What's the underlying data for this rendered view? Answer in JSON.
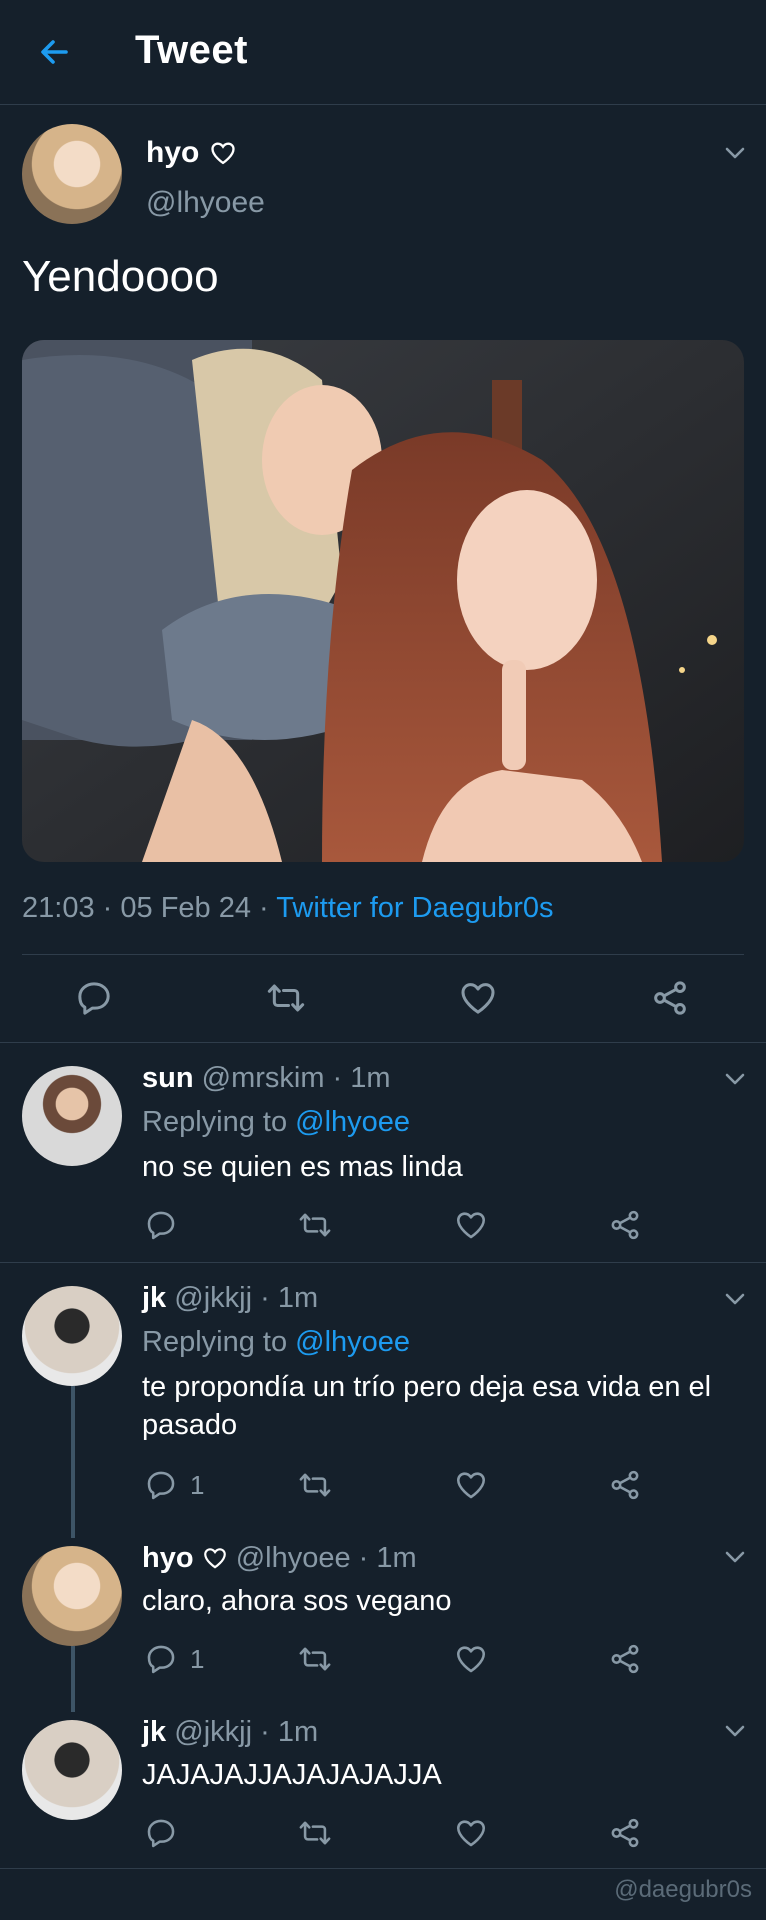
{
  "header": {
    "title": "Tweet"
  },
  "main_tweet": {
    "name": "hyo",
    "handle": "@lhyoee",
    "text": "Yendoooo",
    "time": "21:03",
    "date": "05 Feb 24",
    "sep": "·",
    "client": "Twitter for Daegubr0s"
  },
  "replies": [
    {
      "name": "sun",
      "handle": "@mrskim",
      "time": "1m",
      "replying_prefix": "Replying to",
      "replying_to": "@lhyoee",
      "text": "no se quien es mas linda",
      "reply_count": ""
    },
    {
      "name": "jk",
      "handle": "@jkkjj",
      "time": "1m",
      "replying_prefix": "Replying to",
      "replying_to": "@lhyoee",
      "text": "te propondía un trío pero deja esa vida en el pasado",
      "reply_count": "1"
    },
    {
      "name": "hyo",
      "handle": "@lhyoee",
      "time": "1m",
      "text": "claro, ahora sos vegano",
      "reply_count": "1"
    },
    {
      "name": "jk",
      "handle": "@jkkjj",
      "time": "1m",
      "text": "JAJAJAJJAJAJAJAJJA",
      "reply_count": ""
    }
  ],
  "watermark": "@daegubr0s",
  "colors": {
    "background": "#15202b",
    "accent": "#1d9bf0",
    "muted": "#8899a6",
    "divider": "#2f3d4b"
  },
  "icons": [
    "back-arrow-icon",
    "chevron-down-icon",
    "reply-icon",
    "retweet-icon",
    "like-icon",
    "share-icon",
    "heart-outline-icon"
  ]
}
